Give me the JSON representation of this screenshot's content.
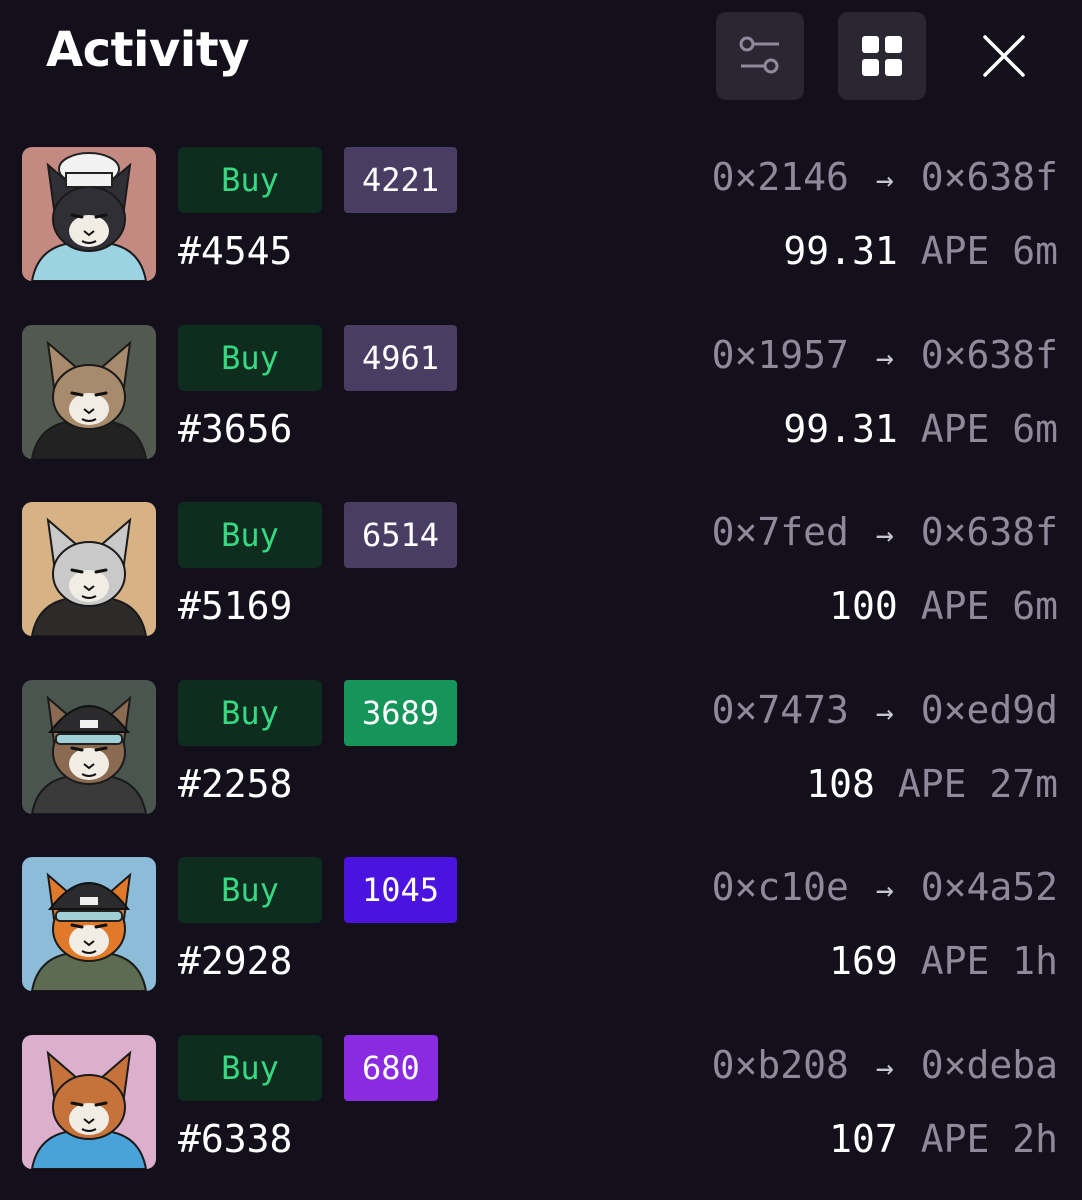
{
  "header": {
    "title": "Activity",
    "filter_icon": "sliders-icon",
    "grid_icon": "grid-icon",
    "close_icon": "close-icon"
  },
  "colors": {
    "background": "#130f1b",
    "buy_bg": "#0f2d1f",
    "buy_text": "#36d982",
    "muted": "#8e8a9a"
  },
  "items": [
    {
      "action": "Buy",
      "rank": "4221",
      "rank_color": "#4a3d63",
      "token": "#4545",
      "from": "0×2146",
      "to": "0×638f",
      "amount": "99.31",
      "currency": "APE",
      "age": "6m",
      "avatar_bg": "#c48a82",
      "fur": "#2f2f35",
      "accent": "#9bd3e3",
      "hat": "chef"
    },
    {
      "action": "Buy",
      "rank": "4961",
      "rank_color": "#4a3d63",
      "token": "#3656",
      "from": "0×1957",
      "to": "0×638f",
      "amount": "99.31",
      "currency": "APE",
      "age": "6m",
      "avatar_bg": "#525a50",
      "fur": "#a88a6c",
      "accent": "#222",
      "hat": "none"
    },
    {
      "action": "Buy",
      "rank": "6514",
      "rank_color": "#4a3d63",
      "token": "#5169",
      "from": "0×7fed",
      "to": "0×638f",
      "amount": "100",
      "currency": "APE",
      "age": "6m",
      "avatar_bg": "#d7b285",
      "fur": "#c9c9c9",
      "accent": "#2d2a2a",
      "hat": "none"
    },
    {
      "action": "Buy",
      "rank": "3689",
      "rank_color": "#15955a",
      "token": "#2258",
      "from": "0×7473",
      "to": "0×ed9d",
      "amount": "108",
      "currency": "APE",
      "age": "27m",
      "avatar_bg": "#4a5550",
      "fur": "#8b6a52",
      "accent": "#3b3a3a",
      "hat": "beanie"
    },
    {
      "action": "Buy",
      "rank": "1045",
      "rank_color": "#4a13e0",
      "token": "#2928",
      "from": "0×c10e",
      "to": "0×4a52",
      "amount": "169",
      "currency": "APE",
      "age": "1h",
      "avatar_bg": "#8cbcd8",
      "fur": "#e07a2a",
      "accent": "#5d6b52",
      "hat": "beanie"
    },
    {
      "action": "Buy",
      "rank": "680",
      "rank_color": "#8a2be2",
      "token": "#6338",
      "from": "0×b208",
      "to": "0×deba",
      "amount": "107",
      "currency": "APE",
      "age": "2h",
      "avatar_bg": "#dcb0cc",
      "fur": "#c5733a",
      "accent": "#4aa3d8",
      "hat": "none"
    }
  ]
}
